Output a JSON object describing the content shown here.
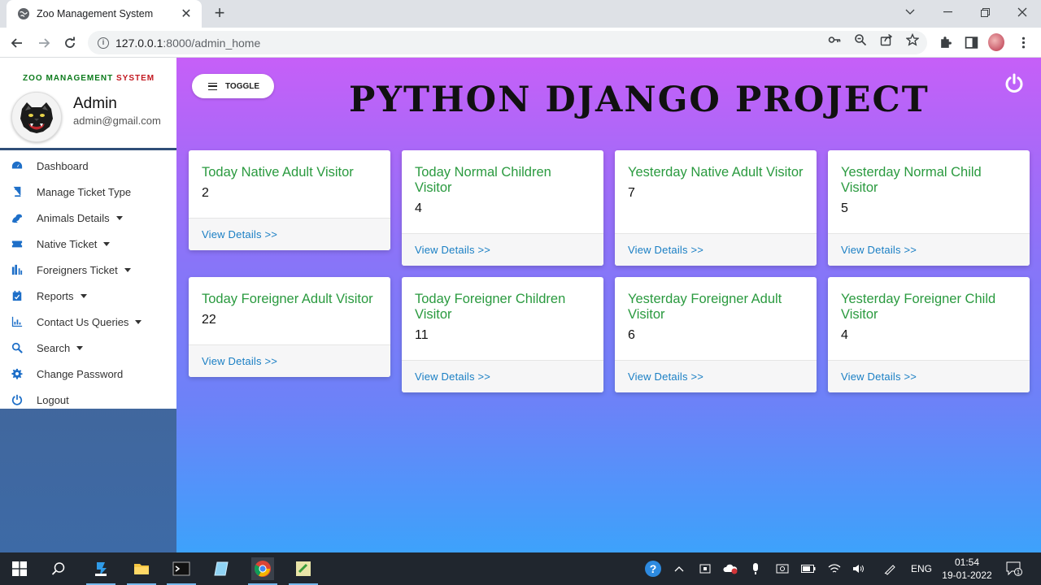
{
  "browser": {
    "tab_title": "Zoo Management System",
    "tab_close": "✕",
    "new_tab": "+",
    "url_host": "127.0.0.1",
    "url_path": ":8000/admin_home"
  },
  "sidebar": {
    "brand_a": "ZOO MANAGEMENT ",
    "brand_b": "SYSTEM",
    "admin_name": "Admin",
    "admin_email": "admin@gmail.com",
    "items": [
      {
        "label": "Dashboard",
        "icon": "dashboard-icon",
        "dropdown": false
      },
      {
        "label": "Manage Ticket Type",
        "icon": "book-icon",
        "dropdown": false
      },
      {
        "label": "Animals Details",
        "icon": "frog-icon",
        "dropdown": true
      },
      {
        "label": "Native Ticket",
        "icon": "ticket-icon",
        "dropdown": true
      },
      {
        "label": "Foreigners Ticket",
        "icon": "sort-icon",
        "dropdown": true
      },
      {
        "label": "Reports",
        "icon": "calendar-icon",
        "dropdown": true
      },
      {
        "label": "Contact Us Queries",
        "icon": "chart-icon",
        "dropdown": true
      },
      {
        "label": "Search",
        "icon": "search-icon",
        "dropdown": true
      },
      {
        "label": "Change Password",
        "icon": "gear-icon",
        "dropdown": false
      },
      {
        "label": "Logout",
        "icon": "power-icon",
        "dropdown": false
      }
    ]
  },
  "header": {
    "toggle_label": "TOGGLE",
    "title": "PYTHON DJANGO PROJECT"
  },
  "cards": [
    {
      "title": "Today Native Adult Visitor",
      "value": "2",
      "link": "View Details >>"
    },
    {
      "title": "Today Normal Children Visitor",
      "value": "4",
      "link": "View Details >>"
    },
    {
      "title": "Yesterday Native Adult Visitor",
      "value": "7",
      "link": "View Details >>"
    },
    {
      "title": "Yesterday Normal Child Visitor",
      "value": "5",
      "link": "View Details >>"
    },
    {
      "title": "Today Foreigner Adult Visitor",
      "value": "22",
      "link": "View Details >>"
    },
    {
      "title": "Today Foreigner Children Visitor",
      "value": "11",
      "link": "View Details >>"
    },
    {
      "title": "Yesterday Foreigner Adult Visitor",
      "value": "6",
      "link": "View Details >>"
    },
    {
      "title": "Yesterday Foreigner Child Visitor",
      "value": "4",
      "link": "View Details >>"
    }
  ],
  "taskbar": {
    "language": "ENG",
    "time": "01:54",
    "date": "19-01-2022",
    "notification_count": "1"
  },
  "colors": {
    "card_title": "#2a9a3f",
    "link": "#1a7fc4",
    "menu_icon": "#1e6fc8",
    "brand_green": "#0b7a1b",
    "brand_red": "#c2171f"
  }
}
